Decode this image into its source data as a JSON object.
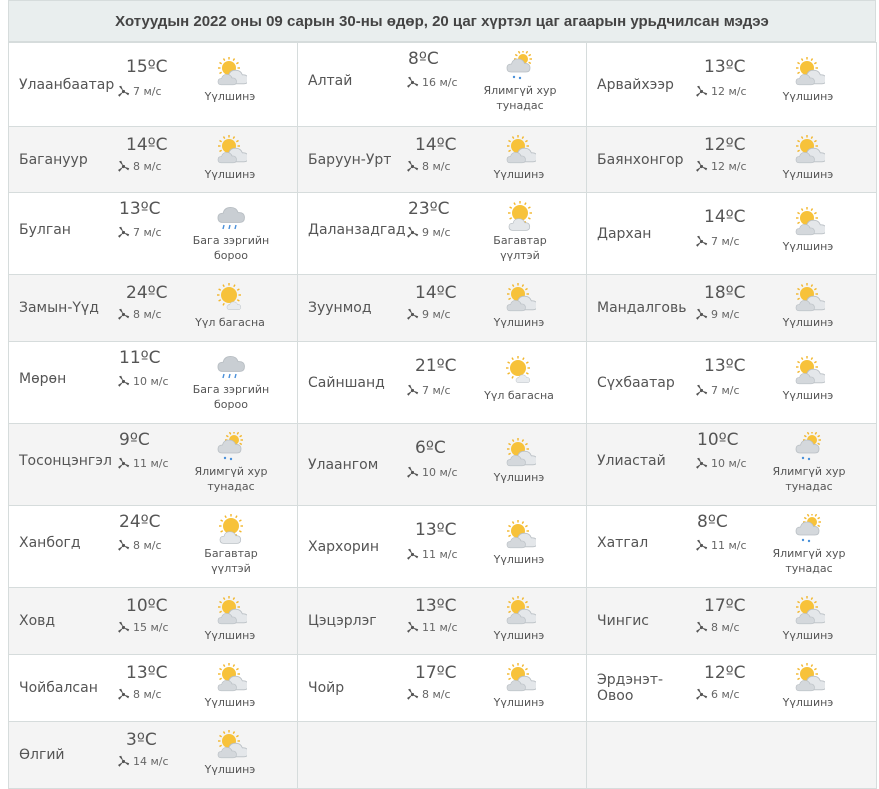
{
  "title": "Хотуудын 2022 оны 09 сарын 30-ны өдөр, 20 цаг хүртэл цаг агаарын урьдчилсан мэдээ",
  "rows": [
    [
      {
        "city": "Улаанбаатар",
        "temp": "15ºC",
        "wind": "7 м/с",
        "icon": "partly-cloudy-sun-icon",
        "desc": "Үүлшинэ"
      },
      {
        "city": "Алтай",
        "temp": "8ºC",
        "wind": "16 м/с",
        "icon": "cloud-sun-light-rain-icon",
        "desc": "Ялимгүй хур тунадас"
      },
      {
        "city": "Арвайхээр",
        "temp": "13ºC",
        "wind": "12 м/с",
        "icon": "partly-cloudy-sun-icon",
        "desc": "Үүлшинэ"
      }
    ],
    [
      {
        "city": "Багануур",
        "temp": "14ºC",
        "wind": "8 м/с",
        "icon": "partly-cloudy-sun-icon",
        "desc": "Үүлшинэ"
      },
      {
        "city": "Баруун-Урт",
        "temp": "14ºC",
        "wind": "8 м/с",
        "icon": "partly-cloudy-sun-icon",
        "desc": "Үүлшинэ"
      },
      {
        "city": "Баянхонгор",
        "temp": "12ºC",
        "wind": "12 м/с",
        "icon": "partly-cloudy-sun-icon",
        "desc": "Үүлшинэ"
      }
    ],
    [
      {
        "city": "Булган",
        "temp": "13ºC",
        "wind": "7 м/с",
        "icon": "rain-cloud-icon",
        "desc": "Бага зэргийн бороо"
      },
      {
        "city": "Даланзадгад",
        "temp": "23ºC",
        "wind": "9 м/с",
        "icon": "mostly-sunny-icon",
        "desc": "Багавтар үүлтэй"
      },
      {
        "city": "Дархан",
        "temp": "14ºC",
        "wind": "7 м/с",
        "icon": "partly-cloudy-sun-icon",
        "desc": "Үүлшинэ"
      }
    ],
    [
      {
        "city": "Замын-Үүд",
        "temp": "24ºC",
        "wind": "8 м/с",
        "icon": "sun-small-cloud-icon",
        "desc": "Үүл багасна"
      },
      {
        "city": "Зуунмод",
        "temp": "14ºC",
        "wind": "9 м/с",
        "icon": "partly-cloudy-sun-icon",
        "desc": "Үүлшинэ"
      },
      {
        "city": "Мандалговь",
        "temp": "18ºC",
        "wind": "9 м/с",
        "icon": "partly-cloudy-sun-icon",
        "desc": "Үүлшинэ"
      }
    ],
    [
      {
        "city": "Мөрөн",
        "temp": "11ºC",
        "wind": "10 м/с",
        "icon": "rain-cloud-icon",
        "desc": "Бага зэргийн бороо"
      },
      {
        "city": "Сайншанд",
        "temp": "21ºC",
        "wind": "7 м/с",
        "icon": "sun-small-cloud-icon",
        "desc": "Үүл багасна"
      },
      {
        "city": "Сүхбаатар",
        "temp": "13ºC",
        "wind": "7 м/с",
        "icon": "partly-cloudy-sun-icon",
        "desc": "Үүлшинэ"
      }
    ],
    [
      {
        "city": "Тосонцэнгэл",
        "temp": "9ºC",
        "wind": "11 м/с",
        "icon": "cloud-sun-light-rain-icon",
        "desc": "Ялимгүй хур тунадас"
      },
      {
        "city": "Улаангом",
        "temp": "6ºC",
        "wind": "10 м/с",
        "icon": "partly-cloudy-sun-icon",
        "desc": "Үүлшинэ"
      },
      {
        "city": "Улиастай",
        "temp": "10ºC",
        "wind": "10 м/с",
        "icon": "cloud-sun-light-rain-icon",
        "desc": "Ялимгүй хур тунадас"
      }
    ],
    [
      {
        "city": "Ханбогд",
        "temp": "24ºC",
        "wind": "8 м/с",
        "icon": "mostly-sunny-icon",
        "desc": "Багавтар үүлтэй"
      },
      {
        "city": "Хархорин",
        "temp": "13ºC",
        "wind": "11 м/с",
        "icon": "partly-cloudy-sun-icon",
        "desc": "Үүлшинэ"
      },
      {
        "city": "Хатгал",
        "temp": "8ºC",
        "wind": "11 м/с",
        "icon": "cloud-sun-light-rain-icon",
        "desc": "Ялимгүй хур тунадас"
      }
    ],
    [
      {
        "city": "Ховд",
        "temp": "10ºC",
        "wind": "15 м/с",
        "icon": "partly-cloudy-sun-icon",
        "desc": "Үүлшинэ"
      },
      {
        "city": "Цэцэрлэг",
        "temp": "13ºC",
        "wind": "11 м/с",
        "icon": "partly-cloudy-sun-icon",
        "desc": "Үүлшинэ"
      },
      {
        "city": "Чингис",
        "temp": "17ºC",
        "wind": "8 м/с",
        "icon": "partly-cloudy-sun-icon",
        "desc": "Үүлшинэ"
      }
    ],
    [
      {
        "city": "Чойбалсан",
        "temp": "13ºC",
        "wind": "8 м/с",
        "icon": "partly-cloudy-sun-icon",
        "desc": "Үүлшинэ"
      },
      {
        "city": "Чойр",
        "temp": "17ºC",
        "wind": "8 м/с",
        "icon": "partly-cloudy-sun-icon",
        "desc": "Үүлшинэ"
      },
      {
        "city": "Эрдэнэт-Овоо",
        "temp": "12ºC",
        "wind": "6 м/с",
        "icon": "partly-cloudy-sun-icon",
        "desc": "Үүлшинэ"
      }
    ],
    [
      {
        "city": "Өлгий",
        "temp": "3ºC",
        "wind": "14 м/с",
        "icon": "partly-cloudy-sun-icon",
        "desc": "Үүлшинэ"
      }
    ]
  ]
}
